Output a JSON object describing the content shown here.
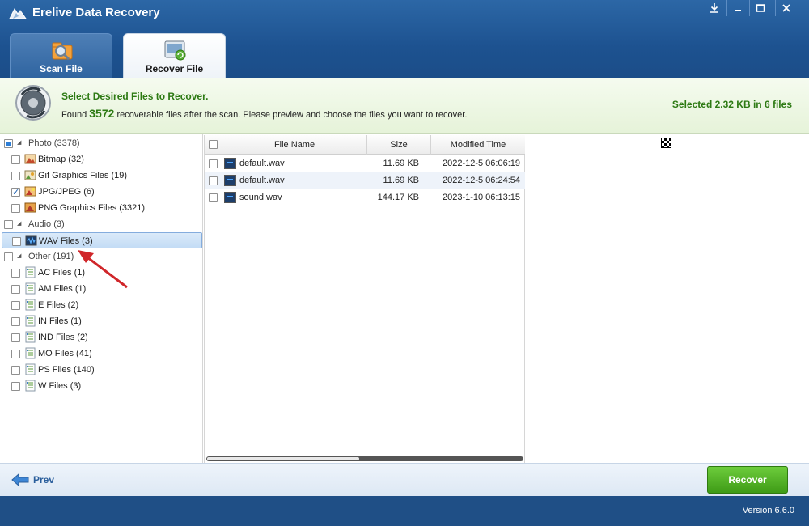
{
  "app": {
    "title": "Erelive Data Recovery",
    "window_buttons": [
      "download-icon",
      "minimize-icon",
      "restore-icon",
      "close-icon"
    ]
  },
  "tabs": [
    {
      "label": "Scan File",
      "icon": "scan-icon",
      "active": false
    },
    {
      "label": "Recover File",
      "icon": "recover-icon",
      "active": true
    }
  ],
  "info": {
    "heading": "Select Desired Files to Recover.",
    "line_prefix": "Found",
    "count": "3572",
    "line_suffix": "recoverable files after the scan. Please preview and choose the files you want to recover.",
    "selected_summary": "Selected 2.32 KB in 6 files"
  },
  "tree": [
    {
      "label": "Photo (3378)",
      "level": 0,
      "state": "partial",
      "icon": "folder-group"
    },
    {
      "label": "Bitmap (32)",
      "level": 1,
      "state": "unchecked",
      "icon": "bitmap-icon"
    },
    {
      "label": "Gif Graphics Files (19)",
      "level": 1,
      "state": "unchecked",
      "icon": "gif-icon"
    },
    {
      "label": "JPG/JPEG (6)",
      "level": 1,
      "state": "checked",
      "icon": "jpg-icon"
    },
    {
      "label": "PNG Graphics Files (3321)",
      "level": 1,
      "state": "unchecked",
      "icon": "png-icon"
    },
    {
      "label": "Audio (3)",
      "level": 0,
      "state": "unchecked",
      "icon": "folder-group"
    },
    {
      "label": "WAV Files (3)",
      "level": 1,
      "state": "unchecked",
      "icon": "wav-icon",
      "selected": true
    },
    {
      "label": "Other (191)",
      "level": 0,
      "state": "unchecked",
      "icon": "folder-group"
    },
    {
      "label": "AC Files (1)",
      "level": 1,
      "state": "unchecked",
      "icon": "document-icon"
    },
    {
      "label": "AM Files (1)",
      "level": 1,
      "state": "unchecked",
      "icon": "document-icon"
    },
    {
      "label": "E Files (2)",
      "level": 1,
      "state": "unchecked",
      "icon": "document-icon"
    },
    {
      "label": "IN Files (1)",
      "level": 1,
      "state": "unchecked",
      "icon": "document-icon"
    },
    {
      "label": "IND Files (2)",
      "level": 1,
      "state": "unchecked",
      "icon": "document-icon"
    },
    {
      "label": "MO Files (41)",
      "level": 1,
      "state": "unchecked",
      "icon": "document-icon"
    },
    {
      "label": "PS Files (140)",
      "level": 1,
      "state": "unchecked",
      "icon": "document-icon"
    },
    {
      "label": "W Files (3)",
      "level": 1,
      "state": "unchecked",
      "icon": "document-icon"
    }
  ],
  "filelist": {
    "columns": [
      "File Name",
      "Size",
      "Modified Time"
    ],
    "rows": [
      {
        "name": "default.wav",
        "size": "11.69 KB",
        "modified": "2022-12-5 06:06:19"
      },
      {
        "name": "default.wav",
        "size": "11.69 KB",
        "modified": "2022-12-5 06:24:54"
      },
      {
        "name": "sound.wav",
        "size": "144.17 KB",
        "modified": "2023-1-10 06:13:15"
      }
    ]
  },
  "footer": {
    "prev_label": "Prev",
    "recover_label": "Recover",
    "version": "Version 6.6.0"
  },
  "colors": {
    "accent_green": "#2d7a13",
    "title_blue": "#1d5290",
    "annotation_red": "#d0262a"
  }
}
